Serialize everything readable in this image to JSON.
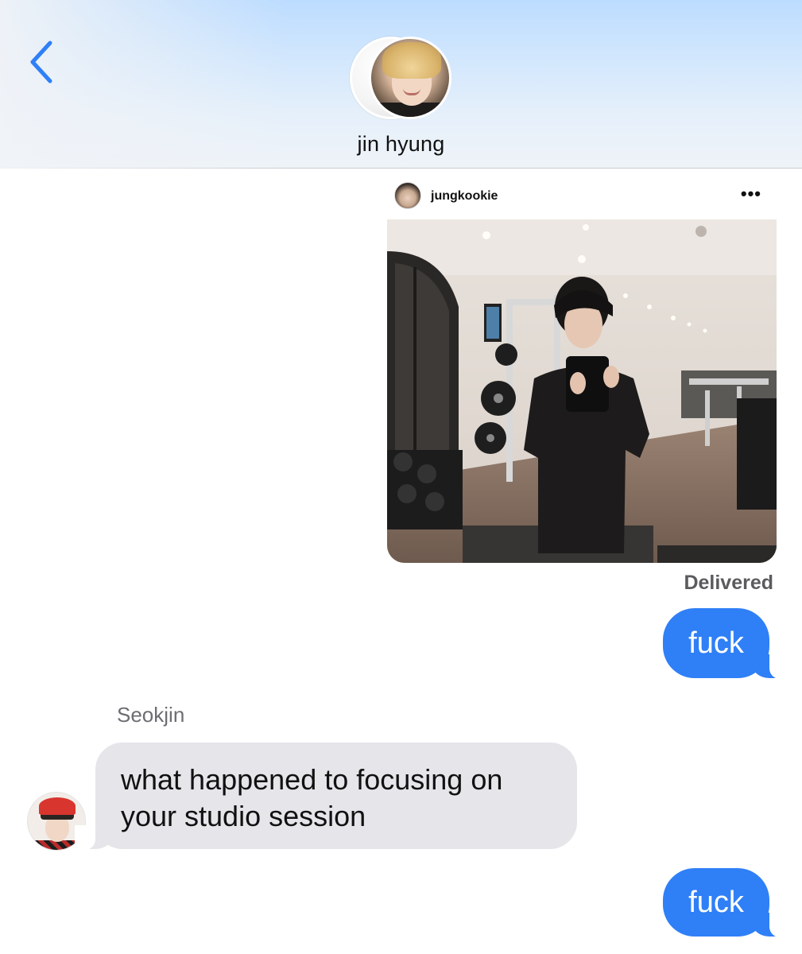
{
  "header": {
    "back_icon": "chevron-left-icon",
    "contact_name": "jin hyung",
    "accent_color": "#2f7ff7"
  },
  "shared_post": {
    "username": "jungkookie",
    "more_label": "•••"
  },
  "status": {
    "delivered": "Delivered"
  },
  "messages": [
    {
      "direction": "outgoing",
      "text": "fuck"
    },
    {
      "direction": "incoming",
      "sender": "Seokjin",
      "lines": [
        "what happened to focusing on",
        "your studio session"
      ]
    },
    {
      "direction": "outgoing",
      "text": "fuck"
    }
  ],
  "colors": {
    "outgoing_bubble": "#2f7ff7",
    "incoming_bubble": "#e5e5ea",
    "status_text": "#5b5b5f"
  }
}
